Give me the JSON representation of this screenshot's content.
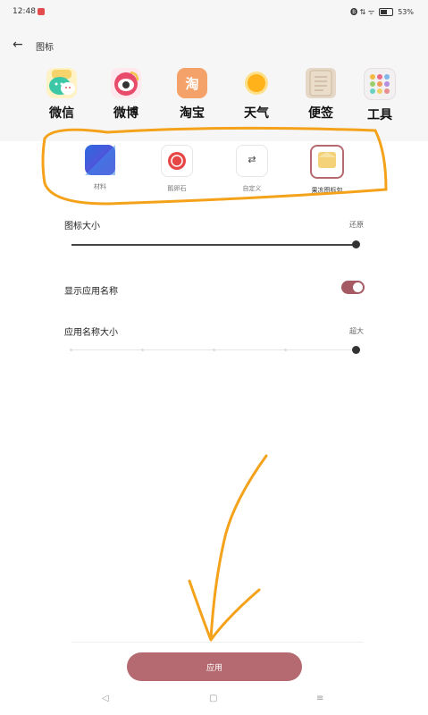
{
  "status_bar": {
    "time": "12:48",
    "icons": "🅑 ⇅ ᯤ",
    "battery": "53%"
  },
  "header": {
    "back_icon": "←",
    "title": "图标"
  },
  "preview_apps": [
    {
      "label": "微信",
      "icon": "wechat-app-icon"
    },
    {
      "label": "微博",
      "icon": "weibo-app-icon"
    },
    {
      "label": "淘宝",
      "icon": "taobao-app-icon",
      "glyph": "淘"
    },
    {
      "label": "天气",
      "icon": "weather-app-icon"
    },
    {
      "label": "便签",
      "icon": "notes-app-icon"
    },
    {
      "label": "工具",
      "icon": "tools-app-icon"
    }
  ],
  "icon_styles": [
    {
      "name": "材料",
      "icon": "material-style-icon"
    },
    {
      "name": "鹅卵石",
      "icon": "pebble-style-icon"
    },
    {
      "name": "自定义",
      "icon": "custom-style-icon",
      "glyph": "⇄"
    },
    {
      "name": "果冻图标包",
      "icon": "jelly-pack-icon"
    }
  ],
  "settings": {
    "icon_size": {
      "label": "图标大小",
      "action": "还原",
      "level": 1.0
    },
    "show_app_name": {
      "label": "显示应用名称",
      "enabled": true
    },
    "app_name_size": {
      "label": "应用名称大小",
      "value": "超大",
      "level": 1.0
    }
  },
  "apply_button": "应用",
  "nav_bar": {
    "back": "◁",
    "home": "▢",
    "menu": "≡"
  },
  "colors": {
    "accent": "#b46a70",
    "toggle": "#a55a63",
    "annotation": "#f5a21b"
  }
}
